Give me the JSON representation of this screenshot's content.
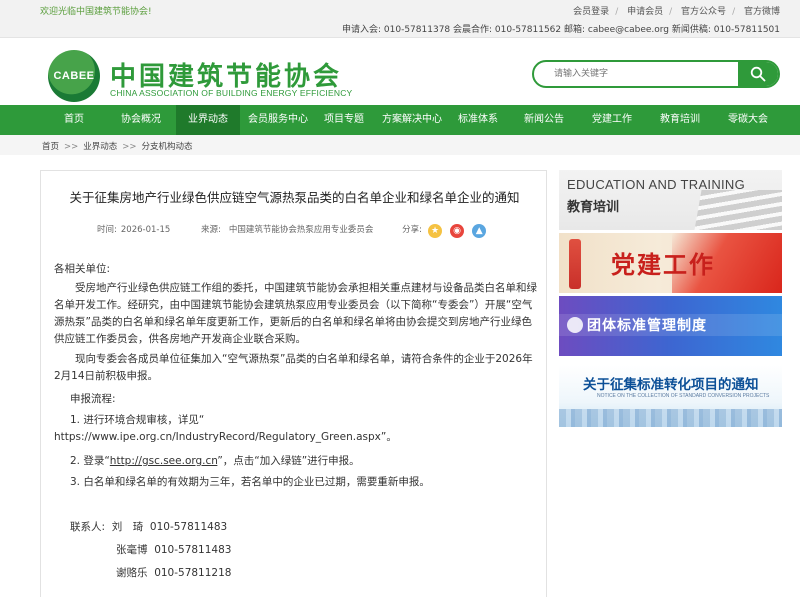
{
  "topbar": {
    "welcome": "欢迎光临中国建筑节能协会!",
    "links": [
      "会员登录",
      "申请会员",
      "官方公众号",
      "官方微博"
    ],
    "contact": "申请入会: 010-57811378 会晨合作: 010-57811562 邮箱: cabee@cabee.org 新闻供稿: 010-57811501"
  },
  "header": {
    "logo_mark": "CABEE",
    "title": "中国建筑节能协会",
    "subtitle": "CHINA ASSOCIATION OF BUILDING ENERGY EFFICIENCY",
    "search_placeholder": "请输入关键字"
  },
  "nav": {
    "items": [
      "首页",
      "协会概况",
      "业界动态",
      "会员服务中心",
      "项目专题",
      "方案解决中心",
      "标准体系",
      "新闻公告",
      "党建工作",
      "教育培训",
      "零碳大会"
    ],
    "active": "业界动态"
  },
  "breadcrumb": [
    "首页",
    "业界动态",
    "分支机构动态"
  ],
  "article": {
    "title": "关于征集房地产行业绿色供应链空气源热泵品类的白名单企业和绿名单企业的通知",
    "date_label": "时间:",
    "date": "2026-01-15",
    "source_label": "来源:",
    "source": "中国建筑节能协会热泵应用专业委员会",
    "share_label": "分享:",
    "greeting": "各相关单位:",
    "para1": "受房地产行业绿色供应链工作组的委托，中国建筑节能协会承担相关重点建材与设备品类白名单和绿名单开发工作。经研究，由中国建筑节能协会建筑热泵应用专业委员会（以下简称“专委会”）开展“空气源热泵”品类的白名单和绿名单年度更新工作，更新后的白名单和绿名单将由协会提交到房地产行业绿色供应链工作委员会，供各房地产开发商企业联合采购。",
    "para2": "现向专委会各成员单位征集加入“空气源热泵”品类的白名单和绿名单，请符合条件的企业于2026年2月14日前积极申报。",
    "flow_title": "申报流程:",
    "step1": "1. 进行环境合规审核，详见“",
    "step1_url": "https://www.ipe.org.cn/IndustryRecord/Regulatory_Green.aspx",
    "step1_end": "”。",
    "step2_pre": "2. 登录“",
    "step2_link": "http://gsc.see.org.cn",
    "step2_post": "”，点击“加入绿链”进行申报。",
    "step3": "3. 白名单和绿名单的有效期为三年，若名单中的企业已过期，需要重新申报。",
    "contact_label": "联系人:",
    "contacts": [
      {
        "name": "刘　琦",
        "phone": "010-57811483"
      },
      {
        "name": "张毫博",
        "phone": "010-57811483"
      },
      {
        "name": "谢赂乐",
        "phone": "010-57811218"
      }
    ]
  },
  "sidebar": {
    "banner1_en": "EDUCATION AND TRAINING",
    "banner1_cn": "教育培训",
    "banner2": "党建工作",
    "banner3": "团体标准管理制度",
    "banner4": "关于征集标准转化项目的通知",
    "banner4_sub": "NOTICE ON THE COLLECTION OF STANDARD CONVERSION PROJECTS"
  },
  "colors": {
    "brand_green": "#2e9a3a",
    "nav_active": "#1f7a2b"
  }
}
